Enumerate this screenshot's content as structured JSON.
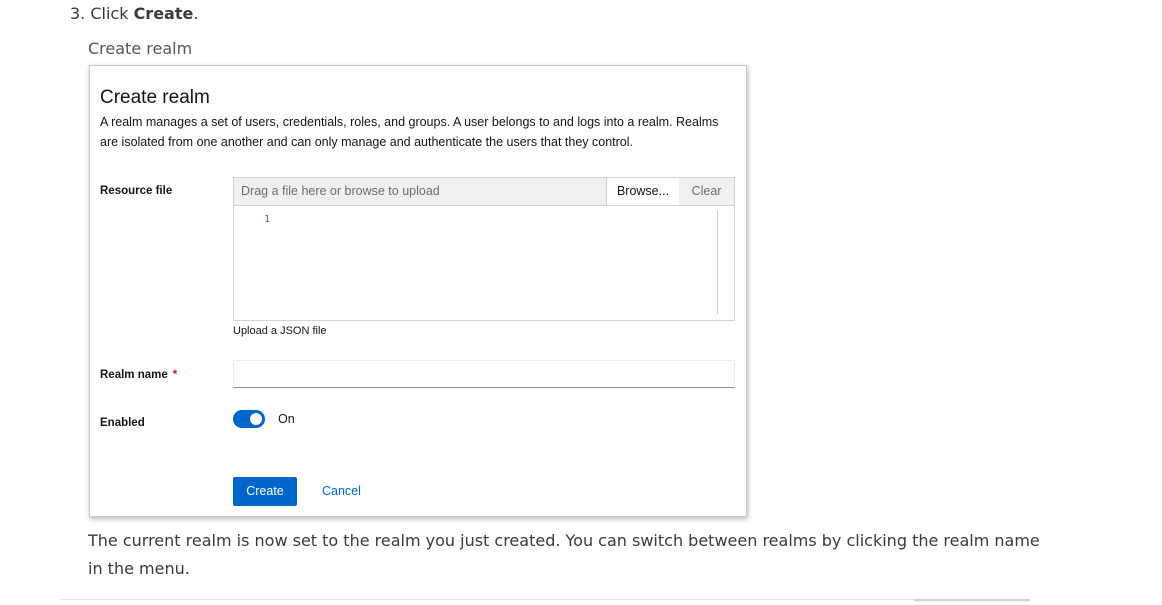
{
  "step": {
    "prefix": "3. Click ",
    "action": "Create",
    "suffix": "."
  },
  "caption": "Create realm",
  "modal": {
    "title": "Create realm",
    "description": "A realm manages a set of users, credentials, roles, and groups. A user belongs to and logs into a realm. Realms are isolated from one another and can only manage and authenticate the users that they control.",
    "resource_file_label": "Resource file",
    "upload_placeholder": "Drag a file here or browse to upload",
    "browse_label": "Browse...",
    "clear_label": "Clear",
    "editor_line_number": "1",
    "upload_helper": "Upload a JSON file",
    "realm_name_label": "Realm name",
    "required_marker": "*",
    "realm_name_value": "",
    "enabled_label": "Enabled",
    "enabled_state": "On",
    "create_label": "Create",
    "cancel_label": "Cancel",
    "colors": {
      "primary": "#0066cc",
      "required": "#c9190b"
    }
  },
  "paragraph": "The current realm is now set to the realm you just created. You can switch between realms by clicking the realm name in the menu."
}
